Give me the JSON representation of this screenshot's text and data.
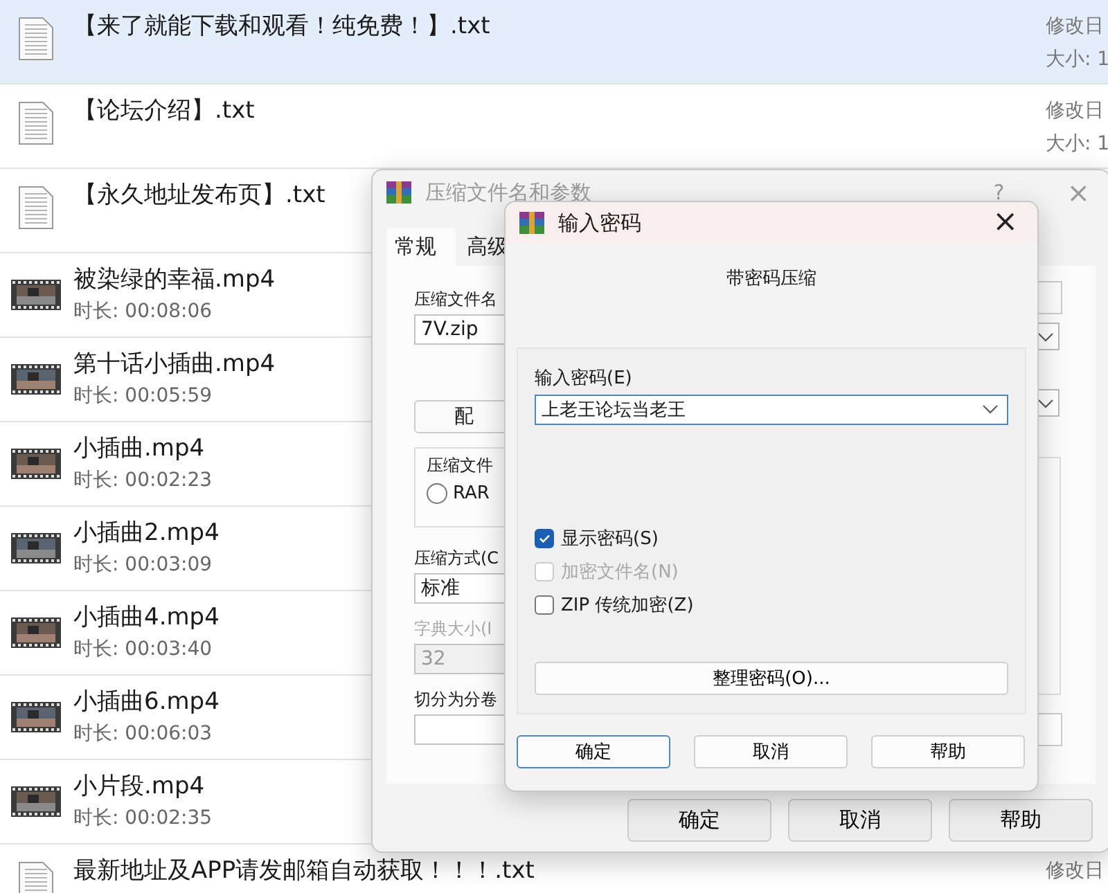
{
  "files": [
    {
      "kind": "text",
      "name": "【来了就能下载和观看！纯免费！】.txt",
      "modified_label": "修改日",
      "size_label": "大小: 1",
      "selected": true
    },
    {
      "kind": "text",
      "name": "【论坛介绍】.txt",
      "modified_label": "修改日",
      "size_label": "大小: 1",
      "selected": false
    },
    {
      "kind": "text",
      "name": "【永久地址发布页】.txt",
      "selected": false
    },
    {
      "kind": "video",
      "name": "被染绿的幸福.mp4",
      "duration": "时长: 00:08:06",
      "selected": false
    },
    {
      "kind": "video",
      "name": "第十话小插曲.mp4",
      "duration": "时长: 00:05:59",
      "selected": false
    },
    {
      "kind": "video",
      "name": "小插曲.mp4",
      "duration": "时长: 00:02:23",
      "selected": false
    },
    {
      "kind": "video",
      "name": "小插曲2.mp4",
      "duration": "时长: 00:03:09",
      "selected": false
    },
    {
      "kind": "video",
      "name": "小插曲4.mp4",
      "duration": "时长: 00:03:40",
      "selected": false
    },
    {
      "kind": "video",
      "name": "小插曲6.mp4",
      "duration": "时长: 00:06:03",
      "selected": false
    },
    {
      "kind": "video",
      "name": "小片段.mp4",
      "duration": "时长: 00:02:35",
      "selected": false
    },
    {
      "kind": "text",
      "name": "最新地址及APP请发邮箱自动获取！！！.txt",
      "modified_label": "修改日",
      "selected": false
    }
  ],
  "archive_dialog": {
    "title": "压缩文件名和参数",
    "help": "?",
    "close": "×",
    "tabs": [
      {
        "label": "常规",
        "selected": true
      },
      {
        "label": "高级",
        "selected": false
      }
    ],
    "archive_name_label": "压缩文件名",
    "archive_name": "7V.zip",
    "profiles_button": "配",
    "format_group": "压缩文件",
    "format_options": [
      {
        "label": "RAR",
        "selected": false
      }
    ],
    "method_label": "压缩方式(C",
    "method_value": "标准",
    "dictionary_label": "字典大小(I",
    "dictionary_value": "32",
    "dictionary_disabled": true,
    "split_label": "切分为分卷",
    "buttons": [
      "确定",
      "取消",
      "帮助"
    ]
  },
  "password_dialog": {
    "title": "输入密码",
    "close": "×",
    "heading": "带密码压缩",
    "password_label": "输入密码(E)",
    "password_value": "上老王论坛当老王",
    "options": [
      {
        "label": "显示密码(S)",
        "checked": true,
        "disabled": false
      },
      {
        "label": "加密文件名(N)",
        "checked": false,
        "disabled": true
      },
      {
        "label": "ZIP 传统加密(Z)",
        "checked": false,
        "disabled": false
      }
    ],
    "organize_button": "整理密码(O)...",
    "buttons": [
      {
        "label": "确定",
        "default": true
      },
      {
        "label": "取消",
        "default": false
      },
      {
        "label": "帮助",
        "default": false
      }
    ]
  }
}
